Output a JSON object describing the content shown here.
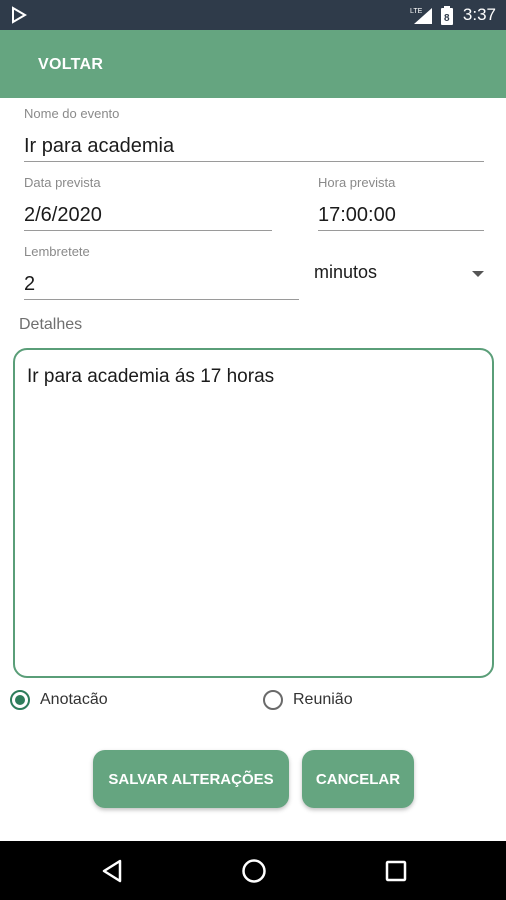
{
  "status_bar": {
    "time": "3:37",
    "network_label": "LTE",
    "battery_level": "8"
  },
  "toolbar": {
    "back_label": "VOLTAR",
    "color": "#65a580"
  },
  "form": {
    "event_name": {
      "label": "Nome do evento",
      "value": "Ir para academia"
    },
    "date": {
      "label": "Data prevista",
      "value": "2/6/2020"
    },
    "time": {
      "label": "Hora prevista",
      "value": "17:00:00"
    },
    "reminder": {
      "label": "Lembretete",
      "value": "2"
    },
    "reminder_unit": {
      "selected": "minutos"
    },
    "details": {
      "label": "Detalhes",
      "value": "Ir para academia ás 17 horas"
    },
    "type_options": [
      {
        "label": "Anotacão",
        "checked": true
      },
      {
        "label": "Reunião",
        "checked": false
      }
    ]
  },
  "actions": {
    "save_label": "SALVAR ALTERAÇÕES",
    "cancel_label": "CANCELAR"
  },
  "icons": {
    "status": [
      "play-store-icon",
      "lte-signal-icon",
      "battery-icon"
    ],
    "nav": [
      "back-triangle-icon",
      "home-circle-icon",
      "recents-square-icon"
    ]
  }
}
